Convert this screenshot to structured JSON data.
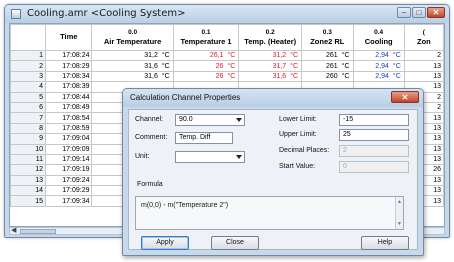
{
  "window": {
    "title": "Cooling.amr <Cooling System>",
    "controls": {
      "minimize": "–",
      "maximize": "□",
      "close": "✕"
    }
  },
  "grid": {
    "columns": [
      {
        "id": "",
        "name": ""
      },
      {
        "id": "",
        "name": "Time"
      },
      {
        "id": "0.0",
        "name": "Air Temperature"
      },
      {
        "id": "0.1",
        "name": "Temperature 1"
      },
      {
        "id": "0.2",
        "name": "Temp. (Heater)"
      },
      {
        "id": "0.3",
        "name": "Zone2 RL"
      },
      {
        "id": "0.4",
        "name": "Cooling"
      },
      {
        "id": "(",
        "name": "Zon"
      }
    ],
    "rows": [
      {
        "n": "1",
        "time": "17:08:24",
        "c0": "31,2",
        "u0": "°C",
        "c1": "26,1",
        "u1": "°C",
        "c2": "31,2",
        "u2": "°C",
        "c3": "261",
        "u3": "°C",
        "c4": "2,94",
        "u4": "°C",
        "c5": "2"
      },
      {
        "n": "2",
        "time": "17:08:29",
        "c0": "31,6",
        "u0": "°C",
        "c1": "26",
        "u1": "°C",
        "c2": "31,7",
        "u2": "°C",
        "c3": "261",
        "u3": "°C",
        "c4": "2,94",
        "u4": "°C",
        "c5": "13"
      },
      {
        "n": "3",
        "time": "17:08:34",
        "c0": "31,6",
        "u0": "°C",
        "c1": "26",
        "u1": "°C",
        "c2": "31,6",
        "u2": "°C",
        "c3": "260",
        "u3": "°C",
        "c4": "2,94",
        "u4": "°C",
        "c5": "13"
      },
      {
        "n": "4",
        "time": "17:08:39",
        "c5": "13"
      },
      {
        "n": "5",
        "time": "17:08:44",
        "c5": "2"
      },
      {
        "n": "6",
        "time": "17:08:49",
        "c5": "2"
      },
      {
        "n": "7",
        "time": "17:08:54",
        "c5": "13"
      },
      {
        "n": "8",
        "time": "17:08:59",
        "c5": "13"
      },
      {
        "n": "9",
        "time": "17:09:04",
        "c5": "13"
      },
      {
        "n": "10",
        "time": "17:09:09",
        "c5": "13"
      },
      {
        "n": "11",
        "time": "17:09:14",
        "c5": "13"
      },
      {
        "n": "12",
        "time": "17:09:19",
        "c5": "26"
      },
      {
        "n": "13",
        "time": "17:09:24",
        "c5": "13"
      },
      {
        "n": "14",
        "time": "17:09:29",
        "c5": "13"
      },
      {
        "n": "15",
        "time": "17:09:34",
        "c5": "13"
      }
    ],
    "colors": {
      "red": "#d8202a",
      "blue": "#2040c0"
    }
  },
  "dialog": {
    "title": "Calculation Channel Properties",
    "channel_label": "Channel:",
    "channel_value": "90.0",
    "comment_label": "Comment:",
    "comment_value": "Temp. Diff",
    "unit_label": "Unit:",
    "unit_value": "",
    "lower_limit_label": "Lower Limit:",
    "lower_limit_value": "-15",
    "upper_limit_label": "Upper Limit:",
    "upper_limit_value": "25",
    "decimal_places_label": "Decimal Places:",
    "decimal_places_value": "2",
    "start_value_label": "Start Value:",
    "start_value_value": "0",
    "formula_label": "Formula",
    "formula_value": "m(0,0) - m(\"Temperature 2\")",
    "apply_label": "Apply",
    "close_label": "Close",
    "help_label": "Help"
  }
}
